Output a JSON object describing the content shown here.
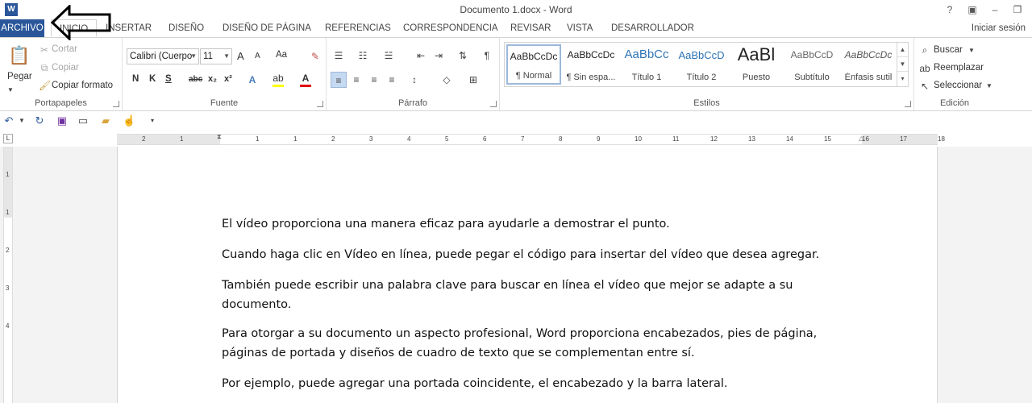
{
  "title_bar": {
    "doc_title": "Documento 1.docx - Word",
    "help_icon": "?",
    "app_icon_letter": "W"
  },
  "tabs": {
    "file": "ARCHIVO",
    "items": [
      "INICIO",
      "INSERTAR",
      "DISEÑO",
      "DISEÑO DE PÁGINA",
      "REFERENCIAS",
      "CORRESPONDENCIA",
      "REVISAR",
      "VISTA",
      "DESARROLLADOR"
    ],
    "signin": "Iniciar sesión",
    "active": "INICIO"
  },
  "ribbon": {
    "clipboard": {
      "label": "Portapapeles",
      "paste": "Pegar",
      "cut": "Cortar",
      "copy": "Copiar",
      "format_painter": "Copiar formato"
    },
    "font": {
      "label": "Fuente",
      "font_name": "Calibri (Cuerpo",
      "font_size": "11",
      "grow": "A",
      "shrink": "A",
      "case": "Aa",
      "bold": "N",
      "italic": "K",
      "underline": "S",
      "strike": "abc",
      "subscript": "x₂",
      "superscript": "x²"
    },
    "paragraph": {
      "label": "Párrafo",
      "pilcrow": "¶"
    },
    "styles": {
      "label": "Estilos",
      "items": [
        {
          "preview": "AaBbCcDc",
          "name": "¶ Normal"
        },
        {
          "preview": "AaBbCcDc",
          "name": "¶ Sin espa..."
        },
        {
          "preview": "AaBbCc",
          "name": "Título 1"
        },
        {
          "preview": "AaBbCcD",
          "name": "Título 2"
        },
        {
          "preview": "AaBl",
          "name": "Puesto"
        },
        {
          "preview": "AaBbCcD",
          "name": "Subtítulo"
        },
        {
          "preview": "AaBbCcDc",
          "name": "Énfasis sutil"
        }
      ]
    },
    "editing": {
      "label": "Edición",
      "find": "Buscar",
      "replace": "Reemplazar",
      "select": "Seleccionar"
    }
  },
  "ruler": {
    "corner": "L",
    "numbers": [
      "2",
      "1",
      "1",
      "1",
      "2",
      "3",
      "4",
      "5",
      "6",
      "7",
      "8",
      "9",
      "10",
      "11",
      "12",
      "13",
      "14",
      "15",
      "16",
      "17",
      "18"
    ],
    "vertical_numbers": [
      "1",
      "1",
      "2",
      "3",
      "4"
    ]
  },
  "document": {
    "paragraphs": [
      "El vídeo proporciona una manera eficaz para ayudarle a demostrar el punto.",
      "Cuando haga clic en Vídeo en línea, puede pegar el código para insertar del vídeo que desea agregar.",
      "También puede escribir una palabra clave para buscar en línea el vídeo que mejor se adapte a su documento.",
      "Para otorgar a su documento un aspecto profesional, Word proporciona encabezados, pies de página, páginas de portada y diseños de cuadro de texto que se complementan entre sí.",
      "Por ejemplo, puede agregar una portada coincidente, el encabezado y la barra lateral."
    ]
  },
  "colors": {
    "accent": "#2b579a",
    "font_color_bar": "#e00000",
    "highlight_bar": "#ffff00"
  }
}
